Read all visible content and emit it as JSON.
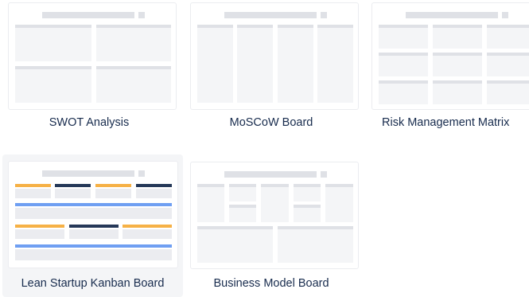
{
  "templates": [
    {
      "label": "SWOT Analysis"
    },
    {
      "label": "MoSCoW Board"
    },
    {
      "label": "Risk Management Matrix"
    },
    {
      "label": "Lean Startup Kanban Board"
    },
    {
      "label": "Business Model Board"
    }
  ],
  "colors": {
    "text": "#172b4d",
    "placeholder_gray": "#dfe1e6",
    "panel_gray": "#f4f5f7",
    "accent_orange": "#f6b146",
    "accent_navy": "#253858",
    "accent_blue": "#6f9ff2"
  }
}
